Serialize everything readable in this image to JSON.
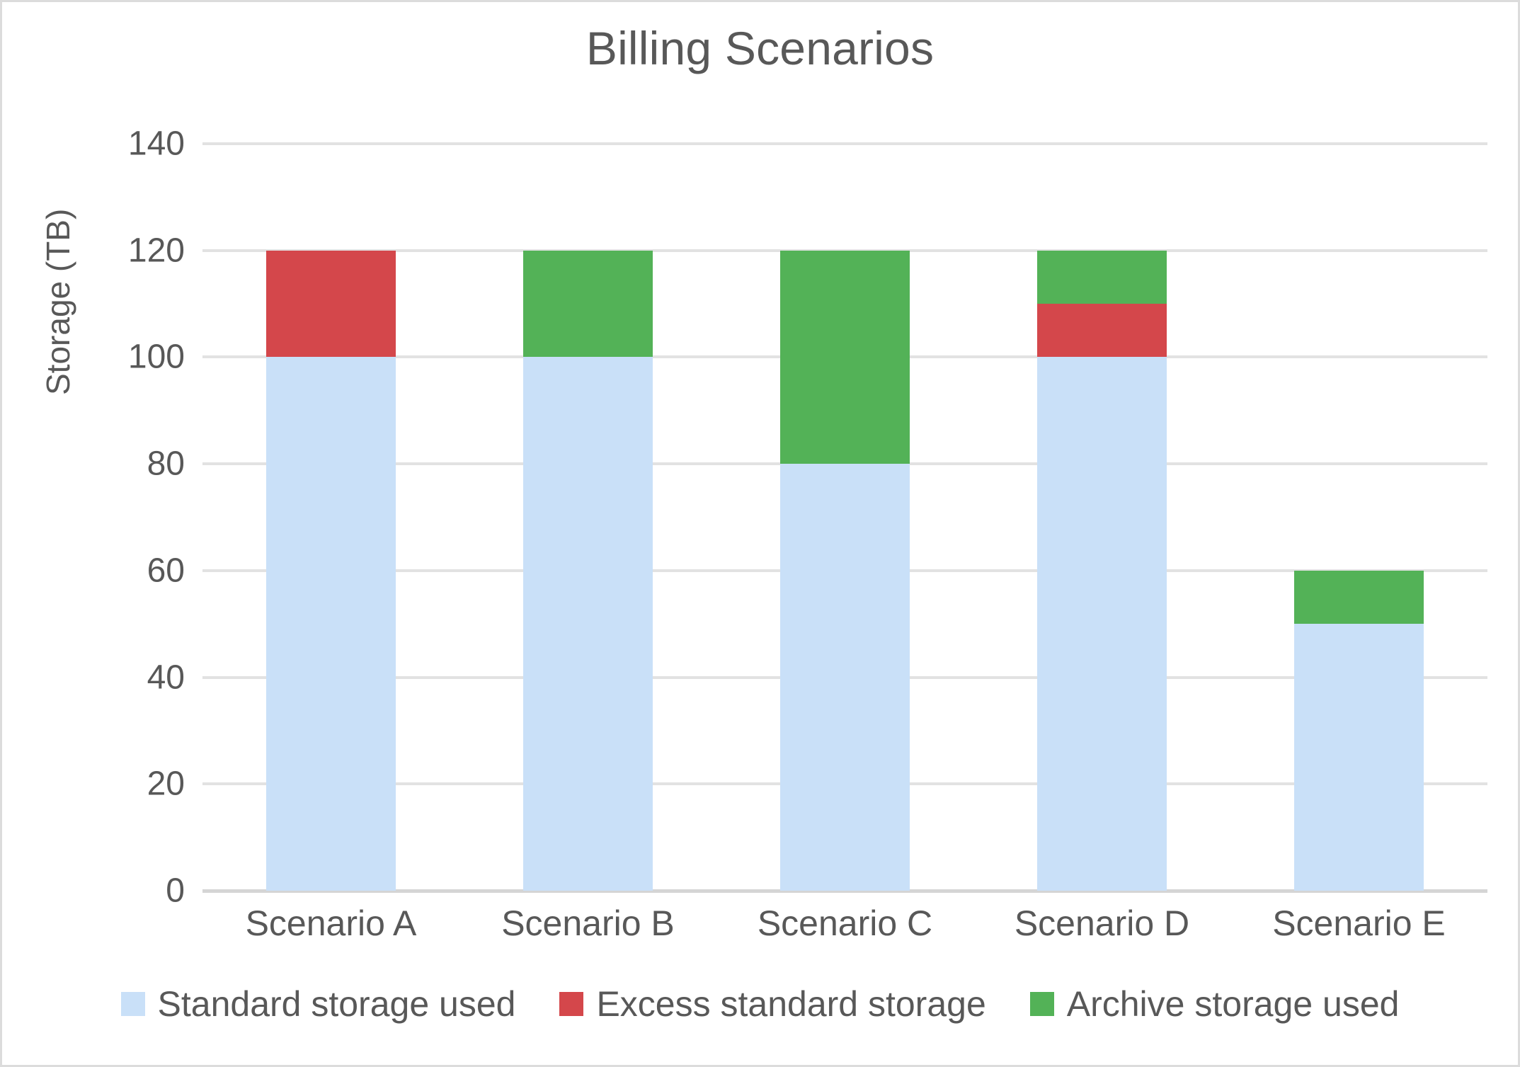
{
  "chart_data": {
    "type": "bar",
    "subtype": "stacked-bar",
    "title": "Billing Scenarios",
    "subtitle": "",
    "xlabel": "",
    "ylabel": "Storage (TB)",
    "categories": [
      "Scenario A",
      "Scenario B",
      "Scenario C",
      "Scenario D",
      "Scenario E"
    ],
    "series": [
      {
        "name": "Standard storage used",
        "color": "#c9e0f8",
        "values": [
          100,
          100,
          80,
          100,
          50
        ]
      },
      {
        "name": "Excess standard storage",
        "color": "#d4474b",
        "values": [
          20,
          0,
          0,
          10,
          0
        ]
      },
      {
        "name": "Archive storage used",
        "color": "#53b257",
        "values": [
          0,
          20,
          40,
          10,
          10
        ]
      }
    ],
    "totals": [
      120,
      120,
      120,
      120,
      60
    ],
    "ylim": [
      0,
      140
    ],
    "ytick_values": [
      0,
      20,
      40,
      60,
      80,
      100,
      120,
      140
    ],
    "ytick_labels": [
      "0",
      "20",
      "40",
      "60",
      "80",
      "100",
      "120",
      "140"
    ],
    "grid": true,
    "grid_axis": "y",
    "legend_position": "bottom",
    "legend": [
      {
        "label": "Standard storage used",
        "color": "#c9e0f8"
      },
      {
        "label": "Excess standard storage",
        "color": "#d4474b"
      },
      {
        "label": "Archive storage used",
        "color": "#53b257"
      }
    ],
    "colors": {
      "standard_storage": "#c9e0f8",
      "excess_standard_storage": "#d4474b",
      "archive_storage": "#53b257",
      "text": "#585858",
      "gridline": "#e2e2e2",
      "axis": "#d5d5d5",
      "background": "#ffffff",
      "border": "#dcdcdc"
    }
  }
}
